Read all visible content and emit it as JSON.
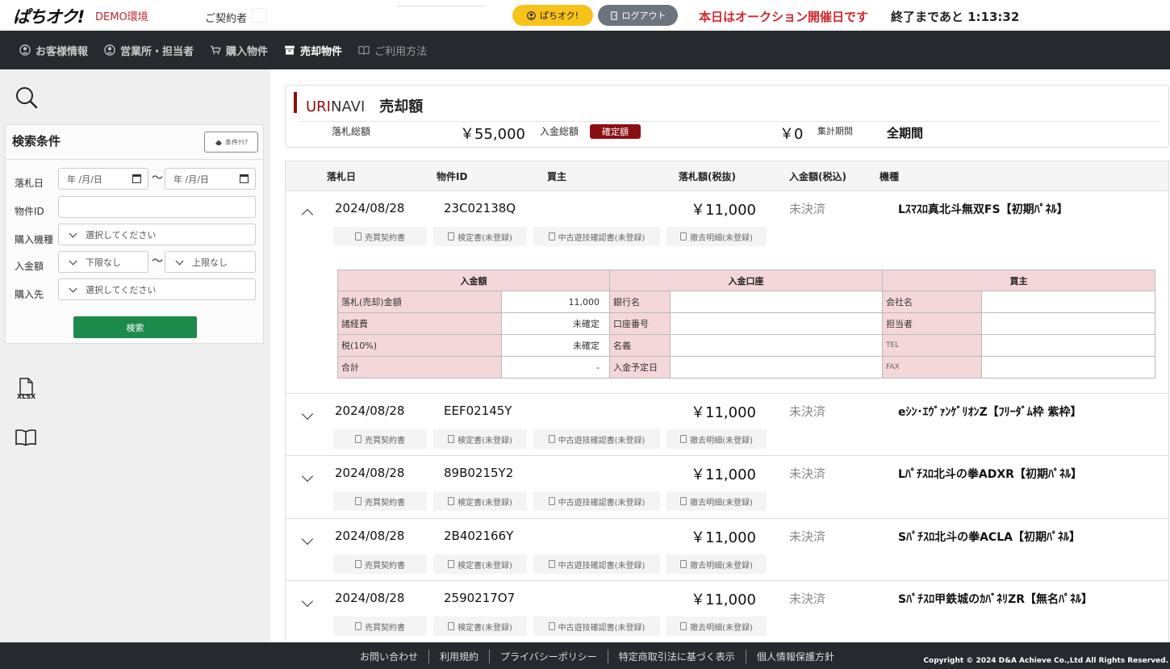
{
  "header": {
    "logo": "ぱちオク!",
    "env_label": "DEMO環境",
    "contract_label": "ご契約者",
    "pachioku_button": "ぱちオク!",
    "logout_button": "ログアウト",
    "auction_message": "本日はオークション開催日です",
    "countdown": "終了まであと 1:13:32"
  },
  "nav": {
    "items": [
      {
        "label": "お客様情報",
        "icon": "user-circle-icon"
      },
      {
        "label": "営業所・担当者",
        "icon": "user-circle-icon"
      },
      {
        "label": "購入物件",
        "icon": "cart-icon"
      },
      {
        "label": "売却物件",
        "icon": "box-icon"
      },
      {
        "label": "ご利用方法",
        "icon": "book-icon"
      }
    ],
    "active": "売却物件"
  },
  "sidebar": {
    "panel_title": "検索条件",
    "clear_button": "条件ｸﾘｱ",
    "fields": {
      "date_label": "落札日",
      "date_from_placeholder": "年 /月/日",
      "date_to_placeholder": "年 /月/日",
      "tilde": "〜",
      "item_id_label": "物件ID",
      "item_id_value": "",
      "model_label": "購入機種",
      "model_placeholder": "選択してください",
      "amount_label": "入金額",
      "amount_min": "下限なし",
      "amount_max": "上限なし",
      "buyer_label": "購入先",
      "buyer_placeholder": "選択してください"
    },
    "search_button": "検索",
    "xlsx_label": "XLSX"
  },
  "summary": {
    "title_uri": "URI",
    "title_navi": "NAVI",
    "title_amount": "売却額",
    "total_bid_label": "落札総額",
    "total_bid_value": "￥55,000",
    "total_paid_label": "入金総額",
    "confirmed_badge": "確定額",
    "total_paid_value": "￥0",
    "period_label": "集計期間",
    "period_value": "全期間"
  },
  "list": {
    "headers": {
      "date": "落札日",
      "id": "物件ID",
      "buyer": "買主",
      "price": "落札額(税抜)",
      "paid": "入金額(税込)",
      "model": "機種"
    },
    "docs": [
      "売買契約書",
      "検定書(未登録)",
      "中古遊技確認書(未登録)",
      "撤去明細(未登録)"
    ],
    "rows": [
      {
        "date": "2024/08/28",
        "id": "23C02138Q",
        "price": "￥11,000",
        "status": "未決済",
        "model": "Lｽﾏｽﾛ真北斗無双FS【初期ﾊﾟﾈﾙ】"
      },
      {
        "date": "2024/08/28",
        "id": "EEF02145Y",
        "price": "￥11,000",
        "status": "未決済",
        "model": "eｼﾝ･ｴｳﾞｧﾝｹﾞﾘｵﾝZ【ﾌﾘｰﾀﾞﾑ枠 紫枠】"
      },
      {
        "date": "2024/08/28",
        "id": "89B0215Y2",
        "price": "￥11,000",
        "status": "未決済",
        "model": "Lﾊﾟﾁｽﾛ北斗の拳ADXR【初期ﾊﾟﾈﾙ】"
      },
      {
        "date": "2024/08/28",
        "id": "2B402166Y",
        "price": "￥11,000",
        "status": "未決済",
        "model": "Sﾊﾟﾁｽﾛ北斗の拳ACLA【初期ﾊﾟﾈﾙ】"
      },
      {
        "date": "2024/08/28",
        "id": "2590217O7",
        "price": "￥11,000",
        "status": "未決済",
        "model": "Sﾊﾟﾁｽﾛ甲鉄城のｶﾊﾞﾈﾘZR【無名ﾊﾟﾈﾙ】"
      }
    ],
    "detail": {
      "section_payment": "入金額",
      "section_account": "入金口座",
      "section_buyer": "買主",
      "bid_amount_label": "落札(売却)金額",
      "bid_amount_value": "11,000",
      "fees_label": "諸経費",
      "fees_value": "未確定",
      "tax_label": "税(10%)",
      "tax_value": "未確定",
      "total_label": "合計",
      "total_value": "-",
      "bank_label": "銀行名",
      "account_no_label": "口座番号",
      "holder_label": "名義",
      "scheduled_label": "入金予定日",
      "company_label": "会社名",
      "contact_label": "担当者",
      "tel_label": "TEL",
      "fax_label": "FAX"
    }
  },
  "footer": {
    "links": [
      "お問い合わせ",
      "利用規約",
      "プライバシーポリシー",
      "特定商取引法に基づく表示",
      "個人情報保護方針"
    ],
    "copyright": "Copyright © 2024 D&A Achieve Co.,Ltd All Rights Reserved."
  },
  "colors": {
    "brand_red": "#8b0e13",
    "alert_red": "#d0282e",
    "nav_bg": "#262a2e",
    "search_green": "#1c8a4a",
    "yellow": "#f7c21a"
  }
}
